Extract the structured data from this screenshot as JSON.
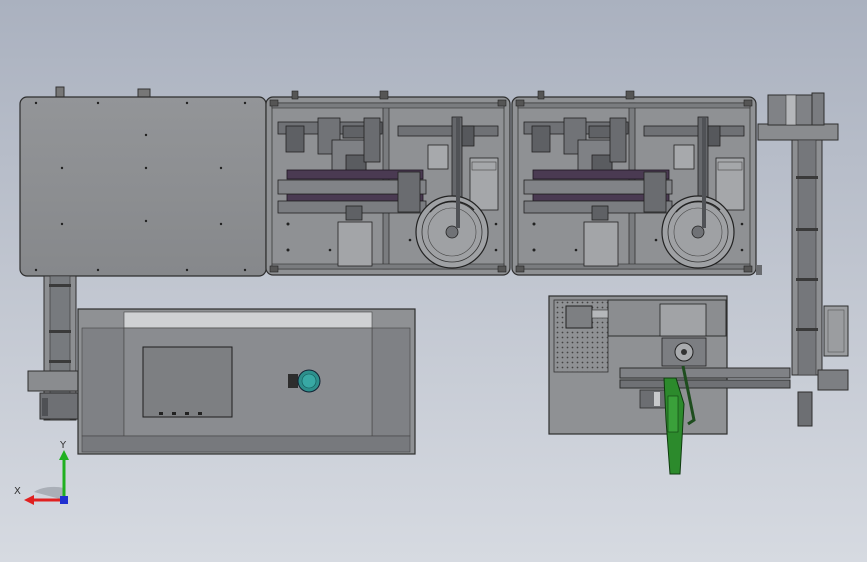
{
  "viewport": {
    "view_name": "",
    "background_top": "#aab1bf",
    "background_bottom": "#d6dae1"
  },
  "model": {
    "components": [
      "top-plate",
      "machine-module-left",
      "machine-module-right",
      "left-vertical-conveyor",
      "control-cabinet",
      "right-vertical-conveyor",
      "bottom-right-station",
      "green-guide-arm"
    ],
    "accent_colors": {
      "frame": "#6b6f73",
      "plate": "#8a8c8f",
      "sheet": "#9a9c9e",
      "rail_purple": "#4a3a52",
      "green_part": "#2c8a2c",
      "teal_knob": "#2d8f8c",
      "red_axis": "#e02020",
      "green_axis": "#20b020",
      "blue_axis": "#2030d0"
    }
  },
  "triad": {
    "x_label": "X",
    "y_label": "Y",
    "icon": "coordinate-triad-icon"
  }
}
